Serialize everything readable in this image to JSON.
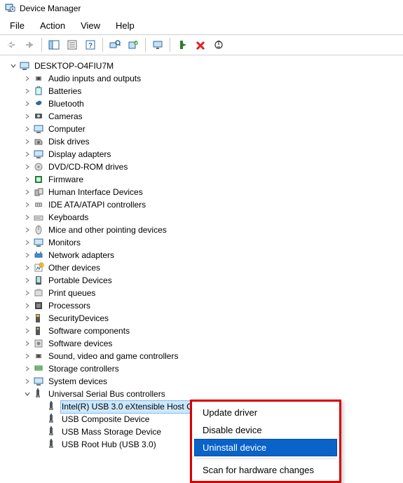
{
  "window": {
    "title": "Device Manager"
  },
  "menu": {
    "file": "File",
    "action": "Action",
    "view": "View",
    "help": "Help"
  },
  "tree": {
    "root": "DESKTOP-O4FIU7M",
    "categories": [
      "Audio inputs and outputs",
      "Batteries",
      "Bluetooth",
      "Cameras",
      "Computer",
      "Disk drives",
      "Display adapters",
      "DVD/CD-ROM drives",
      "Firmware",
      "Human Interface Devices",
      "IDE ATA/ATAPI controllers",
      "Keyboards",
      "Mice and other pointing devices",
      "Monitors",
      "Network adapters",
      "Other devices",
      "Portable Devices",
      "Print queues",
      "Processors",
      "SecurityDevices",
      "Software components",
      "Software devices",
      "Sound, video and game controllers",
      "Storage controllers",
      "System devices",
      "Universal Serial Bus controllers"
    ],
    "usb_children": [
      "Intel(R) USB 3.0 eXtensible Host Controller - 1.0 (Microsoft)",
      "USB Composite Device",
      "USB Mass Storage Device",
      "USB Root Hub (USB 3.0)"
    ],
    "selected_index": 0,
    "expanded_category_index": 25
  },
  "context_menu": {
    "items": [
      "Update driver",
      "Disable device",
      "Uninstall device",
      "Scan for hardware changes"
    ],
    "selected_index": 2
  }
}
